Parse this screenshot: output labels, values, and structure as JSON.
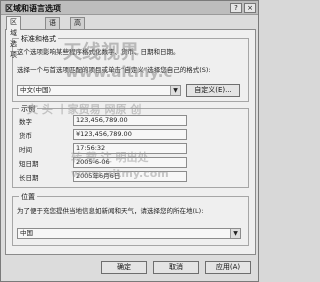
{
  "window": {
    "title": "区域和语言选项",
    "help_button": "?",
    "close_button": "×"
  },
  "tabs": [
    {
      "label": "区域选项"
    },
    {
      "label": "语言"
    },
    {
      "label": "高级"
    }
  ],
  "standards": {
    "group_label": "标准和格式",
    "desc": "这个选项影响某些程序格式化数字、货币、日期和日期。",
    "select_desc": "选择一个与首选项匹配的项目或单击“自定义”选择您自己的格式(S):",
    "selected": "中文(中国)",
    "custom_button": "自定义(E)..."
  },
  "samples": {
    "group_label": "示例",
    "rows": [
      {
        "label": "数字",
        "value": "123,456,789.00"
      },
      {
        "label": "货币",
        "value": "¥123,456,789.00"
      },
      {
        "label": "时间",
        "value": "17:56:32"
      },
      {
        "label": "短日期",
        "value": "2005-6-06"
      },
      {
        "label": "长日期",
        "value": "2005年6月6日"
      }
    ]
  },
  "location": {
    "group_label": "位置",
    "desc": "为了便于充您提供当地信息如新闻和天气，请选择您的所在地(L):",
    "selected": "中国"
  },
  "buttons": {
    "ok": "确定",
    "cancel": "取消",
    "apply": "应用(A)"
  },
  "watermarks": {
    "brand": "天线视界",
    "url": "www.aitmy.c",
    "url2": "www.aitmy.com",
    "line1": "文 头 丨家贸易 网原 创",
    "line2": "转 载 注 明出处"
  }
}
